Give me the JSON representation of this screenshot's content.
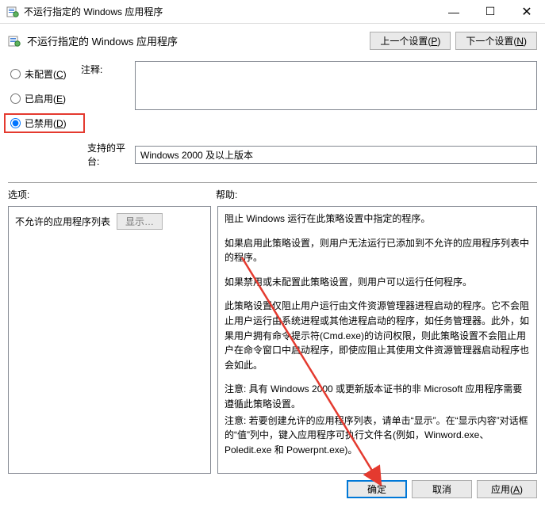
{
  "window": {
    "title": "不运行指定的 Windows 应用程序"
  },
  "header": {
    "policy_title": "不运行指定的 Windows 应用程序",
    "prev": "上一个设置(P)",
    "next": "下一个设置(N)"
  },
  "radios": {
    "not_configured": "未配置(C)",
    "enabled": "已启用(E)",
    "disabled": "已禁用(D)",
    "selected": "disabled"
  },
  "labels": {
    "comment": "注释:",
    "platform": "支持的平台:",
    "options": "选项:",
    "help": "帮助:"
  },
  "platform_text": "Windows 2000 及以上版本",
  "options": {
    "disallowed_label": "不允许的应用程序列表",
    "show_btn": "显示…"
  },
  "help": {
    "p1": "阻止 Windows 运行在此策略设置中指定的程序。",
    "p2": "如果启用此策略设置，则用户无法运行已添加到不允许的应用程序列表中的程序。",
    "p3": "如果禁用或未配置此策略设置，则用户可以运行任何程序。",
    "p4": "此策略设置仅阻止用户运行由文件资源管理器进程启动的程序。它不会阻止用户运行由系统进程或其他进程启动的程序，如任务管理器。此外，如果用户拥有命令提示符(Cmd.exe)的访问权限，则此策略设置不会阻止用户在命令窗口中启动程序，即使应阻止其使用文件资源管理器启动程序也会如此。",
    "p5": "注意: 具有 Windows 2000 或更新版本证书的非 Microsoft 应用程序需要遵循此策略设置。",
    "p6": "注意: 若要创建允许的应用程序列表，请单击“显示”。在“显示内容”对话框的“值”列中，键入应用程序可执行文件名(例如，Winword.exe、Poledit.exe 和 Powerpnt.exe)。"
  },
  "footer": {
    "ok": "确定",
    "cancel": "取消",
    "apply": "应用(A)"
  }
}
